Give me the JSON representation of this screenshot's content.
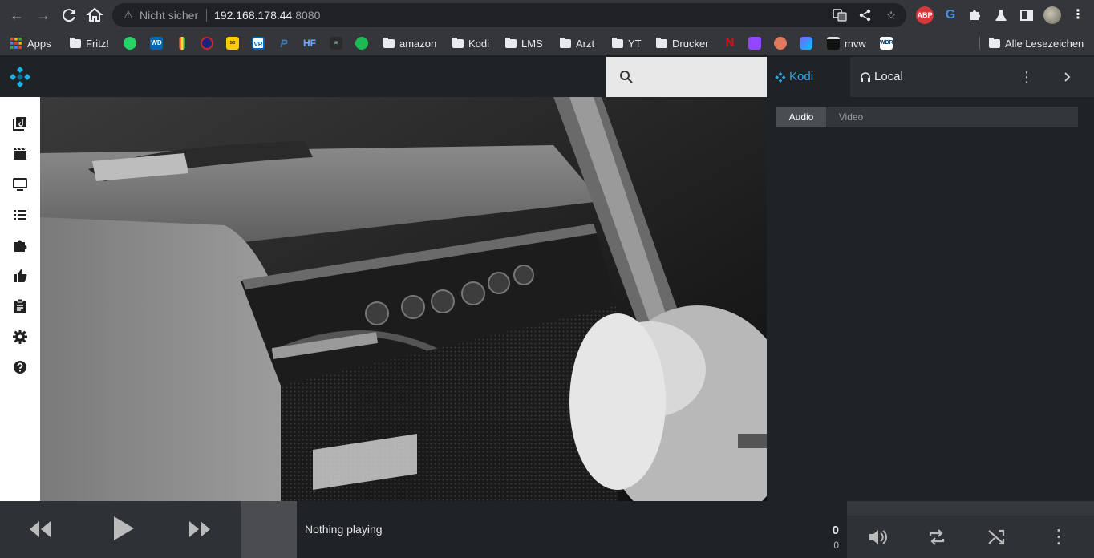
{
  "browser": {
    "address_warning": "Nicht sicher",
    "url_host": "192.168.178.44",
    "url_port": ":8080",
    "extensions": [
      "translate-icon",
      "share-icon",
      "star-icon",
      "abp",
      "grammarly",
      "puzzle-icon",
      "lab-icon",
      "sidepanel-icon",
      "profile-avatar",
      "menu-icon"
    ]
  },
  "bookmarks": [
    {
      "label": "Apps",
      "icon": "apps-grid-icon"
    },
    {
      "label": "Fritz!",
      "icon": "folder-icon"
    },
    {
      "label": "",
      "icon": "whatsapp-icon"
    },
    {
      "label": "",
      "icon": "wd-icon"
    },
    {
      "label": "",
      "icon": "bar-icon"
    },
    {
      "label": "",
      "icon": "circle-icon"
    },
    {
      "label": "",
      "icon": "post-icon"
    },
    {
      "label": "",
      "icon": "bank-icon"
    },
    {
      "label": "",
      "icon": "paypal-icon"
    },
    {
      "label": "",
      "icon": "hf-icon"
    },
    {
      "label": "",
      "icon": "slider-icon"
    },
    {
      "label": "",
      "icon": "spotify-icon"
    },
    {
      "label": "amazon",
      "icon": "folder-icon"
    },
    {
      "label": "Kodi",
      "icon": "folder-icon"
    },
    {
      "label": "LMS",
      "icon": "folder-icon"
    },
    {
      "label": "Arzt",
      "icon": "folder-icon"
    },
    {
      "label": "YT",
      "icon": "folder-icon"
    },
    {
      "label": "Drucker",
      "icon": "folder-icon"
    },
    {
      "label": "",
      "icon": "netflix-icon"
    },
    {
      "label": "",
      "icon": "twitch-icon"
    },
    {
      "label": "",
      "icon": "app-icon"
    },
    {
      "label": "",
      "icon": "app2-icon"
    },
    {
      "label": "mvw",
      "icon": "clapper-icon"
    },
    {
      "label": "",
      "icon": "wdr-icon"
    },
    {
      "label": "Alle Lesezeichen",
      "icon": "folder-icon"
    }
  ],
  "kodi": {
    "logo": "kodi-logo",
    "search_placeholder": "",
    "tabs": {
      "kodi": "Kodi",
      "local": "Local"
    },
    "media_tabs": {
      "audio": "Audio",
      "video": "Video"
    },
    "nav_icons": [
      "music-library-icon",
      "movies-icon",
      "tv-icon",
      "playlist-icon",
      "addons-icon",
      "thumbs-up-icon",
      "clipboard-icon",
      "settings-icon",
      "help-icon"
    ]
  },
  "player": {
    "now_playing": "Nothing playing",
    "time_elapsed": "0",
    "time_total": "0"
  },
  "colors": {
    "accent": "#2ea8e0",
    "header": "#1f2226",
    "player": "#2e3135"
  }
}
